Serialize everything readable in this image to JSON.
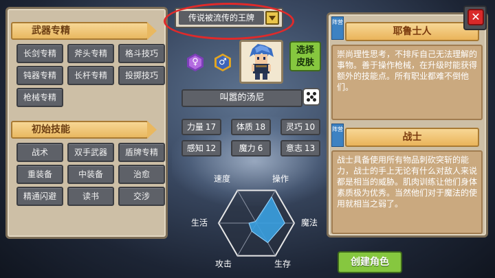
{
  "class_select": {
    "value": "传说被流传的王牌"
  },
  "weapon_section": {
    "title": "武器专精",
    "items": [
      "长剑专精",
      "斧头专精",
      "格斗技巧",
      "钝器专精",
      "长杆专精",
      "投掷技巧",
      "枪械专精"
    ]
  },
  "skill_section": {
    "title": "初始技能",
    "items": [
      "战术",
      "双手武器",
      "盾牌专精",
      "重装备",
      "中装备",
      "治愈",
      "精通闪避",
      "读书",
      "交涉"
    ]
  },
  "gender": {
    "female_symbol": "♀",
    "male_symbol": "♂"
  },
  "skin_button": {
    "line1": "选择",
    "line2": "皮肤"
  },
  "character_name": "叫嚣的汤尼",
  "stats": [
    {
      "label": "力量",
      "value": "17"
    },
    {
      "label": "体质",
      "value": "18"
    },
    {
      "label": "灵巧",
      "value": "10"
    },
    {
      "label": "感知",
      "value": "12"
    },
    {
      "label": "魔力",
      "value": "6"
    },
    {
      "label": "意志",
      "value": "13"
    }
  ],
  "radar": {
    "labels": {
      "speed": "速度",
      "operation": "操作",
      "magic": "魔法",
      "survival": "生存",
      "attack": "攻击",
      "life": "生活"
    },
    "values": {
      "speed": 0.05,
      "operation": 0.8,
      "magic": 0.75,
      "survival": 0.6,
      "attack": 0.25,
      "life": 0.2
    },
    "fill_color": "#3aa0e0"
  },
  "trait_card": {
    "tag": "阵营",
    "title": "耶鲁士人",
    "description": "崇尚理性思考，不排斥自己无法理解的事物。善于操作枪械，在升级时能获得额外的技能点。所有职业都难不倒他们。"
  },
  "class_card": {
    "tag": "阵营",
    "title": "战士",
    "description": "战士具备使用所有物品刺砍突斩的能力，战士的手上无论有什么对敌人来说都是相当的威胁。肌肉训练让他们身体素质极为优秀。当然他们对于魔法的使用就相当之弱了。"
  },
  "close_button": {
    "symbol": "✕"
  },
  "create_button": {
    "label": "创建角色"
  },
  "colors": {
    "accent_green": "#86c73f",
    "panel": "#cdbfa6",
    "highlight_red": "#e02a2a"
  }
}
